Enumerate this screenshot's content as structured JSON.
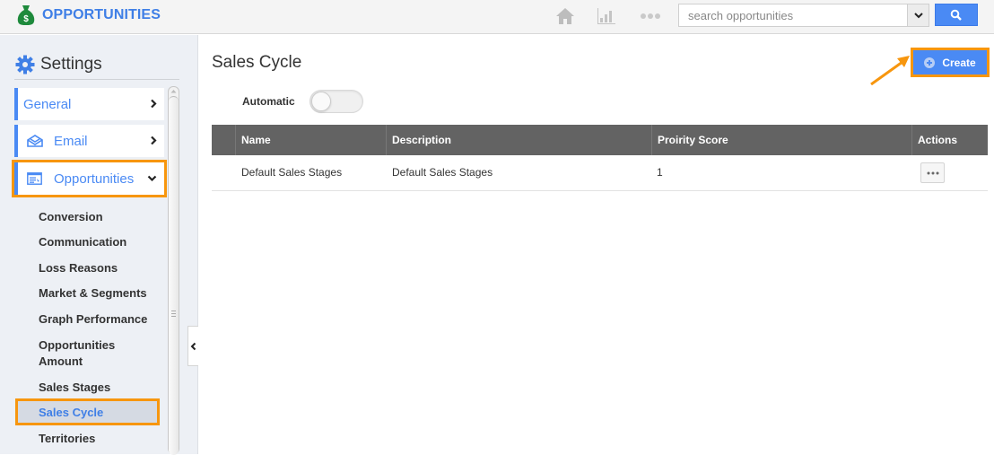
{
  "app": {
    "title": "OPPORTUNITIES",
    "logo_icon": "money-bag-icon",
    "brand_color": "#3f7fe6"
  },
  "topnav": {
    "icons": [
      "home-icon",
      "chart-icon",
      "more-icon"
    ],
    "search": {
      "placeholder": "search opportunities",
      "value": ""
    }
  },
  "sidebar": {
    "title": "Settings",
    "menu": [
      {
        "label": "General",
        "icon": "",
        "state": "collapsed"
      },
      {
        "label": "Email",
        "icon": "email-icon",
        "state": "collapsed"
      },
      {
        "label": "Opportunities",
        "icon": "window-icon",
        "state": "expanded"
      }
    ],
    "submenu": [
      "Conversion",
      "Communication",
      "Loss Reasons",
      "Market & Segments",
      "Graph Performance",
      "Opportunities Amount",
      "Sales Stages",
      "Sales Cycle",
      "Territories"
    ],
    "active_submenu": "Sales Cycle"
  },
  "main": {
    "title": "Sales Cycle",
    "create_label": "Create",
    "automatic_label": "Automatic",
    "automatic_on": false,
    "table": {
      "columns": [
        "Name",
        "Description",
        "Proirity Score",
        "Actions"
      ],
      "rows": [
        {
          "name": "Default Sales Stages",
          "description": "Default Sales Stages",
          "score": "1",
          "actions": "..."
        }
      ]
    }
  },
  "colors": {
    "accent": "#4a8af4",
    "highlight": "#f7960e",
    "header_bg": "#636363"
  }
}
